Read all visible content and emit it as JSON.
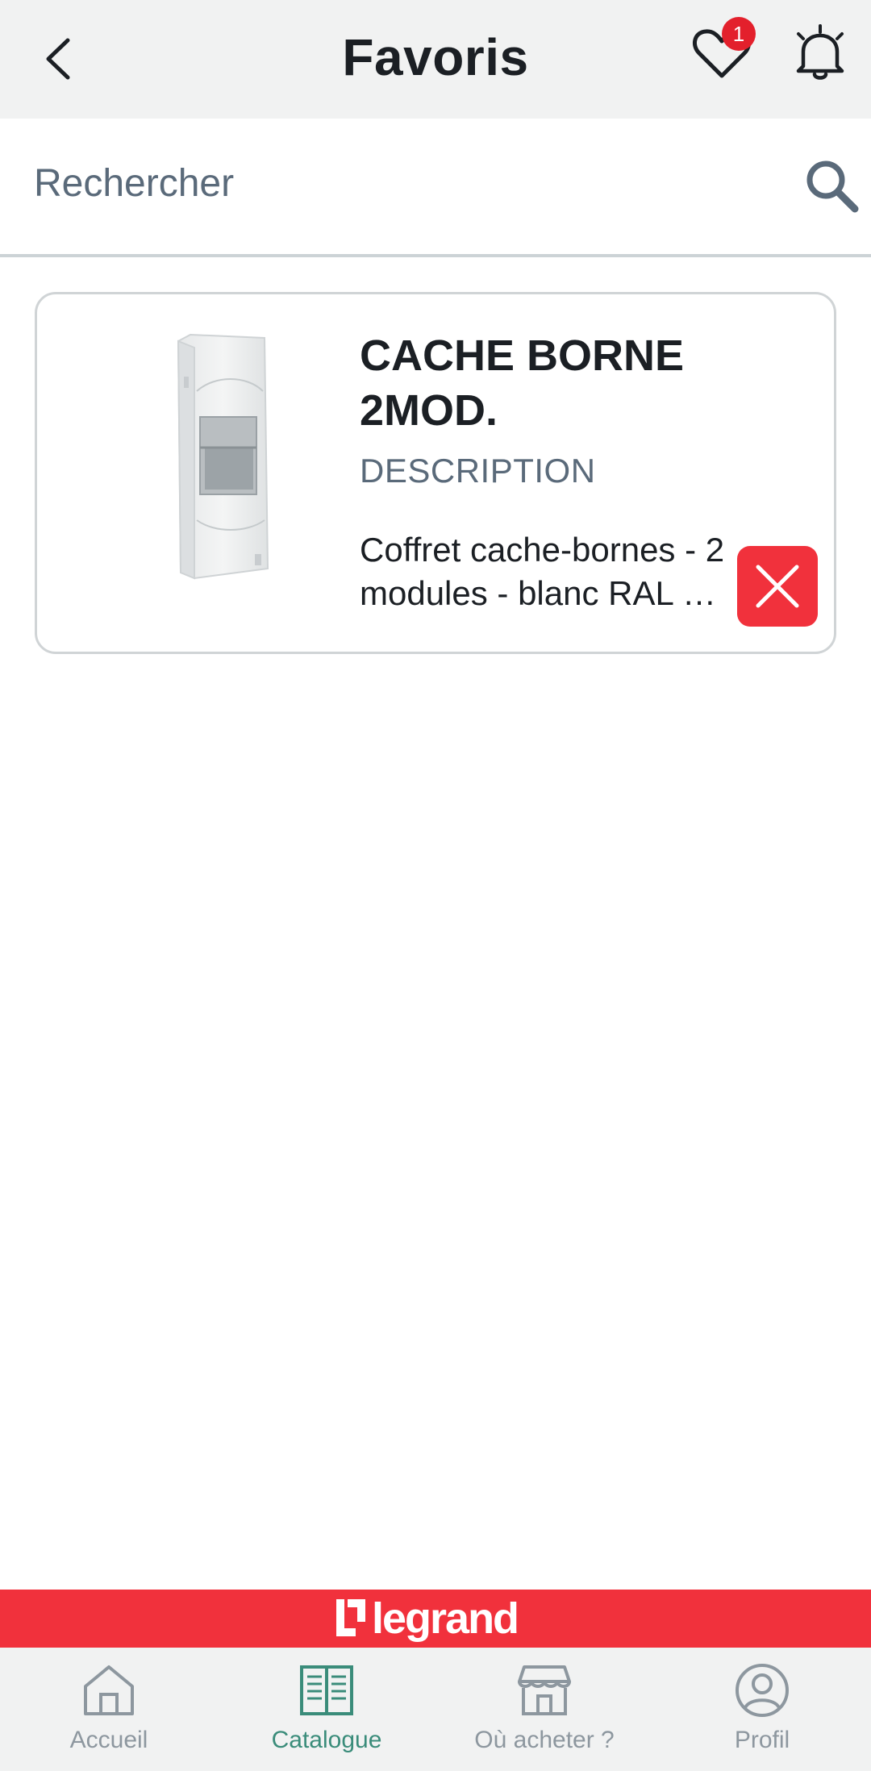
{
  "header": {
    "title": "Favoris",
    "back_icon": "chevron-left-icon",
    "favorites_icon": "heart-icon",
    "favorites_count": "1",
    "notifications_icon": "bell-icon"
  },
  "search": {
    "placeholder": "Rechercher",
    "icon": "search-icon"
  },
  "favorites": [
    {
      "title": "CACHE BORNE 2MOD.",
      "description_label": "DESCRIPTION",
      "description": "Coffret cache-bornes - 2 modules - blanc RAL …",
      "remove_icon": "close-icon"
    }
  ],
  "brand": {
    "name": "legrand",
    "color": "#f1313c"
  },
  "bottom_nav": {
    "items": [
      {
        "label": "Accueil",
        "icon": "home-icon",
        "active": false
      },
      {
        "label": "Catalogue",
        "icon": "book-icon",
        "active": true
      },
      {
        "label": "Où acheter ?",
        "icon": "store-icon",
        "active": false
      },
      {
        "label": "Profil",
        "icon": "user-icon",
        "active": false
      }
    ],
    "active_color": "#3a8c7a",
    "inactive_color": "#8d979f"
  }
}
